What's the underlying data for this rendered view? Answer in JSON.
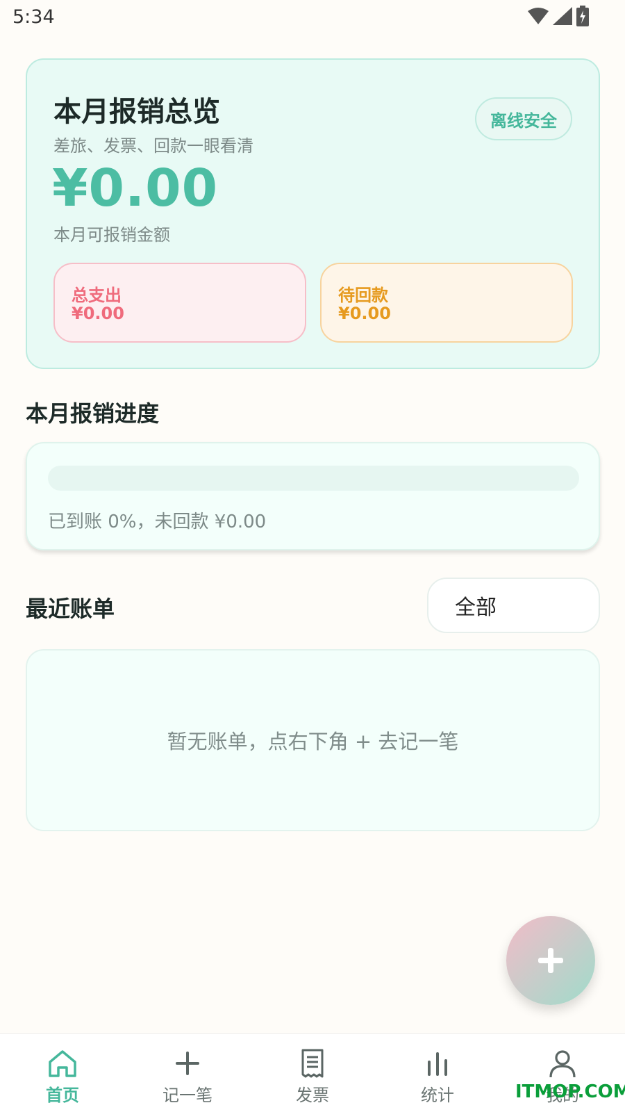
{
  "status_bar": {
    "time": "5:34"
  },
  "summary": {
    "title": "本月报销总览",
    "subtitle": "差旅、发票、回款一眼看清",
    "badge": "离线安全",
    "amount": "¥0.00",
    "amount_label": "本月可报销金额",
    "expense": {
      "label": "总支出",
      "value": "¥0.00"
    },
    "pending": {
      "label": "待回款",
      "value": "¥0.00"
    }
  },
  "progress": {
    "section_title": "本月报销进度",
    "percent": 0,
    "text": "已到账 0%，未回款 ¥0.00"
  },
  "bills": {
    "section_title": "最近账单",
    "filter_value": "全部",
    "empty_text": "暂无账单，点右下角 + 去记一笔"
  },
  "fab": {
    "icon": "plus-icon"
  },
  "nav": {
    "items": [
      {
        "label": "首页",
        "icon": "home-icon",
        "active": true
      },
      {
        "label": "记一笔",
        "icon": "plus-icon",
        "active": false
      },
      {
        "label": "发票",
        "icon": "receipt-icon",
        "active": false
      },
      {
        "label": "统计",
        "icon": "bar-chart-icon",
        "active": false
      },
      {
        "label": "我的",
        "icon": "user-icon",
        "active": false
      }
    ]
  },
  "watermark": "ITMOP.COM",
  "colors": {
    "accent": "#4cbda3",
    "expense": "#ef6b7c",
    "pending": "#e69a1f",
    "background": "#fefcf8"
  }
}
